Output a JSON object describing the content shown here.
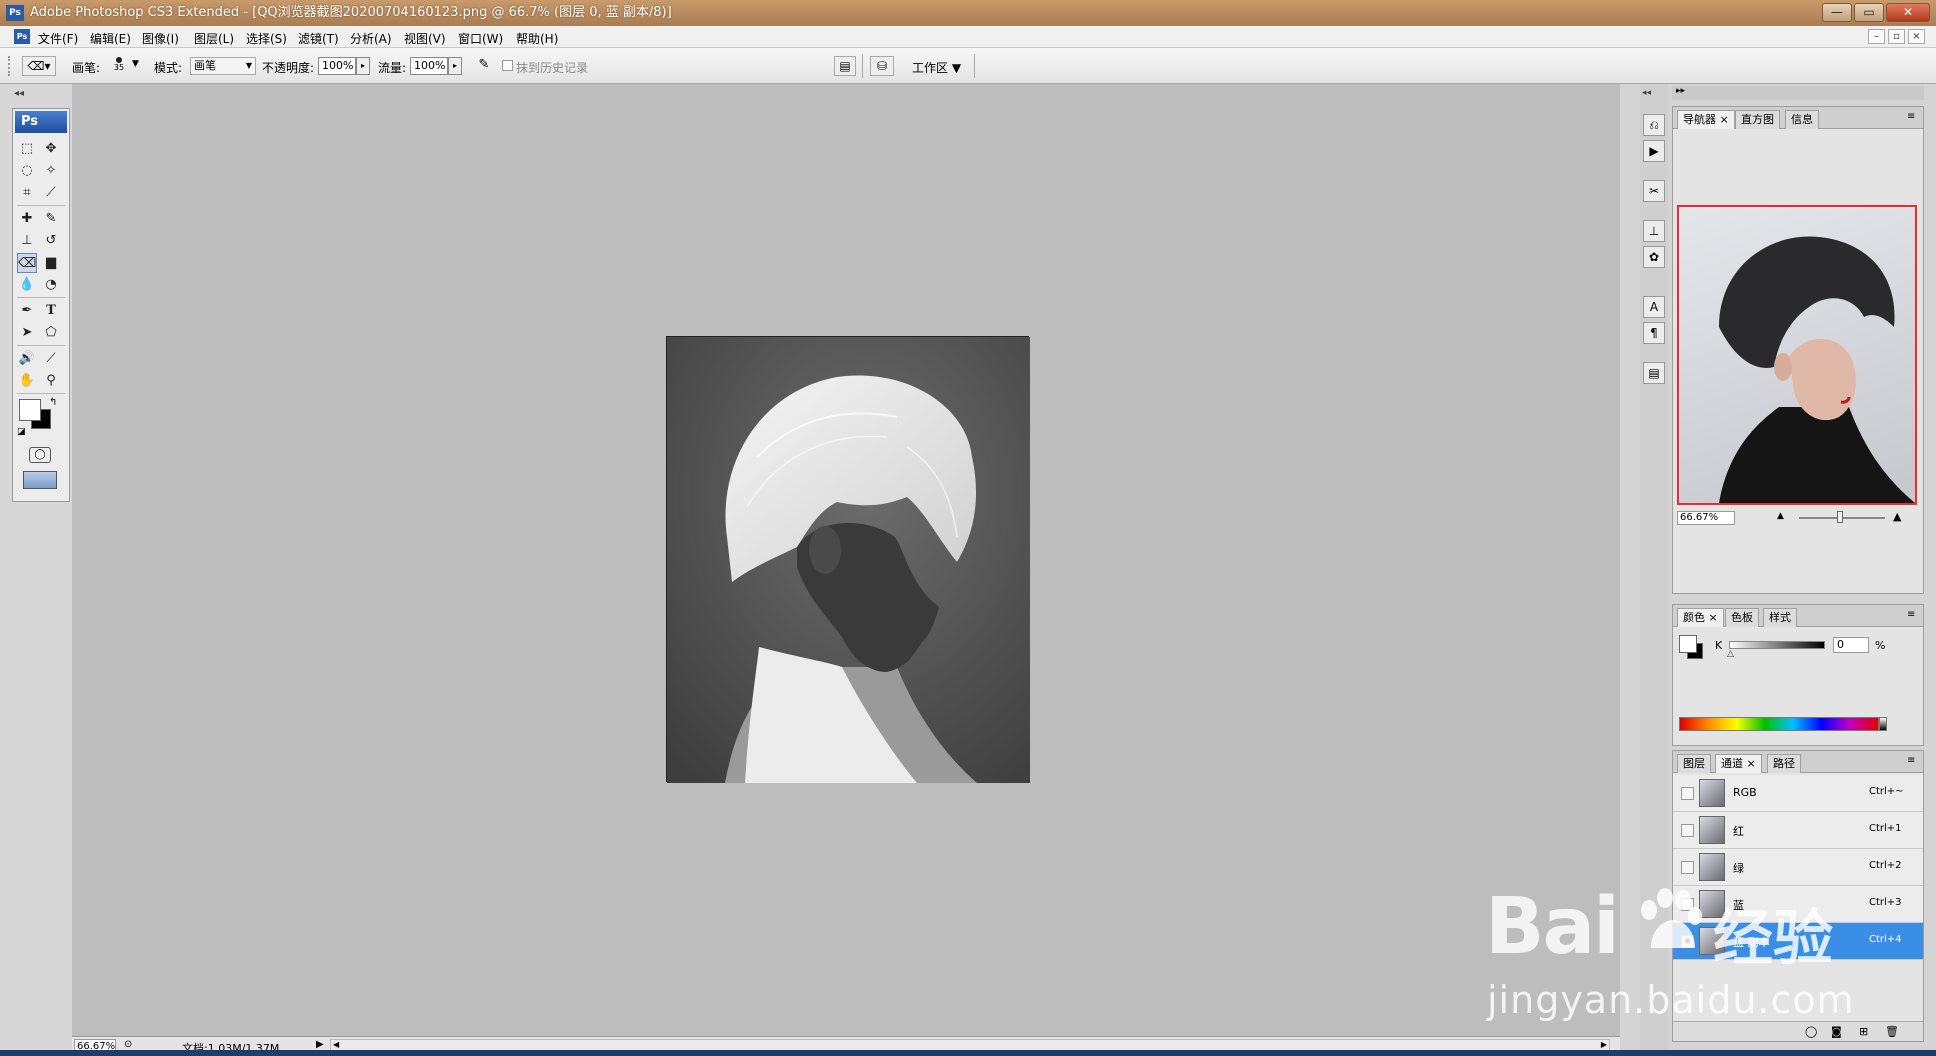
{
  "window": {
    "title": "Adobe Photoshop CS3 Extended - [QQ浏览器截图20200704160123.png @ 66.7% (图层 0, 蓝 副本/8)]",
    "app_icon": "Ps",
    "controls": {
      "minimize": "—",
      "restore": "▭",
      "close": "✕"
    }
  },
  "menubar": {
    "items": [
      "文件(F)",
      "编辑(E)",
      "图像(I)",
      "图层(L)",
      "选择(S)",
      "滤镜(T)",
      "分析(A)",
      "视图(V)",
      "窗口(W)",
      "帮助(H)"
    ]
  },
  "options": {
    "brush_label": "画笔:",
    "brush_size": "35",
    "mode_label": "模式:",
    "mode_value": "画笔",
    "opacity_label": "不透明度:",
    "opacity_value": "100%",
    "flow_label": "流量:",
    "flow_value": "100%",
    "erase_history_label": "抹到历史记录",
    "workspace_label": "工作区 ▼"
  },
  "toolbox": {
    "badge": "Ps"
  },
  "navigator": {
    "tabs": [
      "导航器",
      "直方图",
      "信息"
    ],
    "zoom": "66.67%"
  },
  "color_panel": {
    "tabs": [
      "颜色",
      "色板",
      "样式"
    ],
    "channel_label": "K",
    "value": "0",
    "unit": "%"
  },
  "channels_panel": {
    "tabs": [
      "图层",
      "通道",
      "路径"
    ],
    "rows": [
      {
        "name": "RGB",
        "shortcut": "Ctrl+~"
      },
      {
        "name": "红",
        "shortcut": "Ctrl+1"
      },
      {
        "name": "绿",
        "shortcut": "Ctrl+2"
      },
      {
        "name": "蓝",
        "shortcut": "Ctrl+3"
      },
      {
        "name": "蓝 副本",
        "shortcut": "Ctrl+4"
      }
    ]
  },
  "status": {
    "zoom": "66.67%",
    "doc_size": "文档:1.03M/1.37M"
  },
  "watermark": {
    "brand": "Bai",
    "brand_cn": "经验",
    "url": "jingyan.baidu.com"
  },
  "colors": {
    "selection_blue": "#3a8ee6",
    "navigator_frame": "#e03030",
    "title_bar": "#b98a5e"
  }
}
